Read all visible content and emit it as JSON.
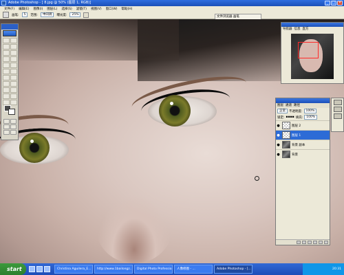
{
  "window": {
    "title": "Adobe Photoshop - [ 8.jpg @ 50% (图层 1, RGB)]",
    "min": "_",
    "max": "□",
    "close": "×"
  },
  "menu": [
    "文件(F)",
    "编辑(E)",
    "图像(I)",
    "图层(L)",
    "选择(S)",
    "滤镜(T)",
    "视图(V)",
    "窗口(W)",
    "帮助(H)"
  ],
  "options": {
    "brush_label": "画笔:",
    "brush_size": "5",
    "range_label": "范围:",
    "range_value": "中间调",
    "exposure_label": "曝光度:",
    "exposure_value": "25%",
    "palette_well": "文件浏览器"
  },
  "doc_tabs": "文件浏览器  画笔",
  "navigator": {
    "tabs": [
      "导航器",
      "信息",
      "直方"
    ]
  },
  "layers": {
    "tabs": [
      "图层",
      "通道",
      "路径"
    ],
    "blend_mode": "正常",
    "opacity_label": "不透明度:",
    "opacity_value": "100%",
    "lock_label": "锁定:",
    "fill_label": "填充:",
    "fill_value": "100%",
    "items": [
      {
        "name": "图层 2",
        "thumb": "trans",
        "visible": true,
        "active": false
      },
      {
        "name": "图层 1",
        "thumb": "trans",
        "visible": true,
        "active": true
      },
      {
        "name": "背景 副本",
        "thumb": "photo",
        "visible": true,
        "active": false
      },
      {
        "name": "背景",
        "thumb": "photo",
        "visible": true,
        "active": false
      }
    ]
  },
  "taskbar": {
    "start": "start",
    "tasks": [
      {
        "label": "Christina Aguilera_E...",
        "active": false
      },
      {
        "label": "http://www.1bailongz...",
        "active": false
      },
      {
        "label": "Digital Photo Professio...",
        "active": false
      },
      {
        "label": "人像修图 - ...",
        "active": false
      },
      {
        "label": "Adobe Photoshop - [...",
        "active": true
      }
    ],
    "clock": "20:31"
  },
  "colors": {
    "titlebar": "#2f6ee0",
    "taskbar": "#1d4db8",
    "active_layer": "#2d6bd6"
  }
}
